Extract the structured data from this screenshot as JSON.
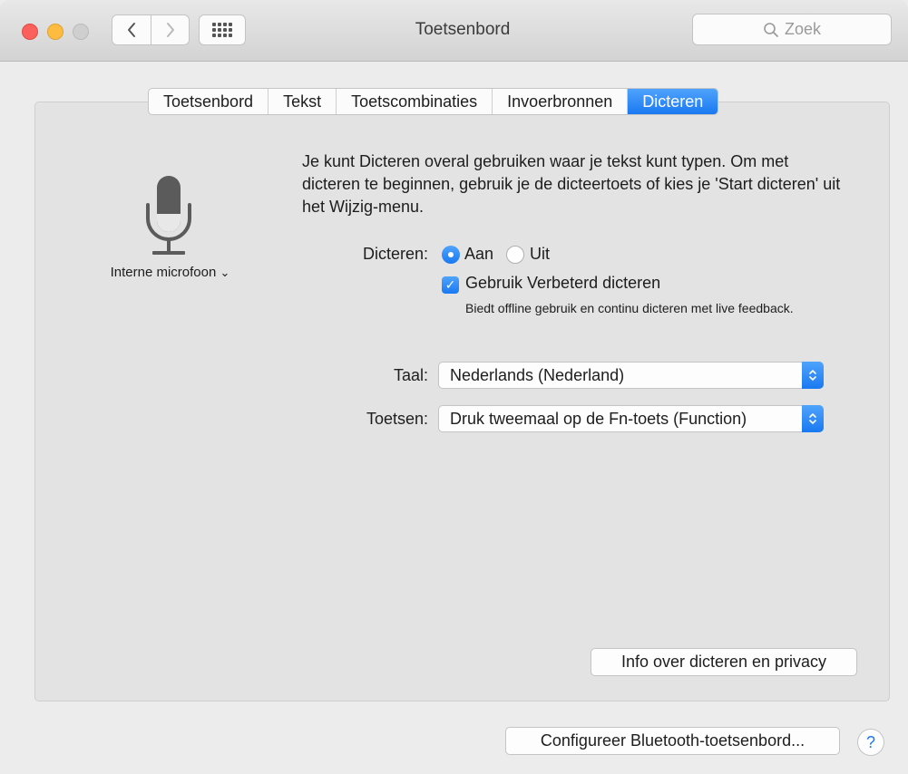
{
  "window": {
    "title": "Toetsenbord",
    "search_placeholder": "Zoek"
  },
  "tabs": [
    {
      "label": "Toetsenbord",
      "active": false
    },
    {
      "label": "Tekst",
      "active": false
    },
    {
      "label": "Toetscombinaties",
      "active": false
    },
    {
      "label": "Invoerbronnen",
      "active": false
    },
    {
      "label": "Dicteren",
      "active": true
    }
  ],
  "microphone": {
    "label": "Interne microfoon",
    "icon": "microphone-icon"
  },
  "description": "Je kunt Dicteren overal gebruiken waar je tekst kunt typen. Om met dicteren te beginnen, gebruik je de dicteertoets of kies je 'Start dicteren' uit het Wijzig-menu.",
  "dictation": {
    "label": "Dicteren:",
    "on_label": "Aan",
    "off_label": "Uit",
    "selected": "Aan"
  },
  "enhanced": {
    "label": "Gebruik Verbeterd dicteren",
    "checked": true,
    "description": "Biedt offline gebruik en continu dicteren met live feedback."
  },
  "language": {
    "label": "Taal:",
    "value": "Nederlands (Nederland)"
  },
  "shortcut": {
    "label": "Toetsen:",
    "value": "Druk tweemaal op de Fn-toets (Function)"
  },
  "buttons": {
    "privacy": "Info over dicteren en privacy",
    "bluetooth": "Configureer Bluetooth-toetsenbord...",
    "help": "?"
  },
  "colors": {
    "accent": "#1a79f2",
    "close": "#fc605c",
    "minimize": "#fdbc40"
  }
}
